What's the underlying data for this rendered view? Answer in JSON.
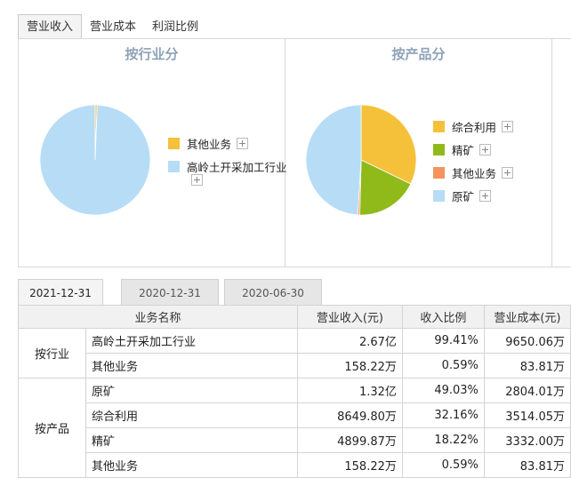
{
  "top_tabs": [
    "营业收入",
    "营业成本",
    "利润比例"
  ],
  "industry_chart": {
    "title": "按行业分",
    "legend": [
      {
        "label": "其他业务",
        "color": "#f5c13a"
      },
      {
        "label": "高岭土开采加工行业",
        "color": "#b7dcf6"
      }
    ]
  },
  "product_chart": {
    "title": "按产品分",
    "legend": [
      {
        "label": "综合利用",
        "color": "#f5c13a"
      },
      {
        "label": "精矿",
        "color": "#8fba1a"
      },
      {
        "label": "其他业务",
        "color": "#f4945c"
      },
      {
        "label": "原矿",
        "color": "#b7dcf6"
      }
    ]
  },
  "chart_data": [
    {
      "type": "pie",
      "title": "按行业分",
      "slices": [
        {
          "label": "其他业务",
          "value": 0.59
        },
        {
          "label": "高岭土开采加工行业",
          "value": 99.41
        }
      ]
    },
    {
      "type": "pie",
      "title": "按产品分",
      "slices": [
        {
          "label": "综合利用",
          "value": 32.16
        },
        {
          "label": "精矿",
          "value": 18.22
        },
        {
          "label": "其他业务",
          "value": 0.59
        },
        {
          "label": "原矿",
          "value": 49.03
        }
      ]
    }
  ],
  "date_tabs": [
    "2021-12-31",
    "2020-12-31",
    "2020-06-30"
  ],
  "table": {
    "headers": [
      "业务名称",
      "营业收入(元)",
      "收入比例",
      "营业成本(元)"
    ],
    "groups": [
      {
        "name": "按行业",
        "rows": [
          [
            "高岭土开采加工行业",
            "2.67亿",
            "99.41%",
            "9650.06万"
          ],
          [
            "其他业务",
            "158.22万",
            "0.59%",
            "83.81万"
          ]
        ]
      },
      {
        "name": "按产品",
        "rows": [
          [
            "原矿",
            "1.32亿",
            "49.03%",
            "2804.01万"
          ],
          [
            "综合利用",
            "8649.80万",
            "32.16%",
            "3514.05万"
          ],
          [
            "精矿",
            "4899.87万",
            "18.22%",
            "3332.00万"
          ],
          [
            "其他业务",
            "158.22万",
            "0.59%",
            "83.81万"
          ]
        ]
      }
    ]
  }
}
